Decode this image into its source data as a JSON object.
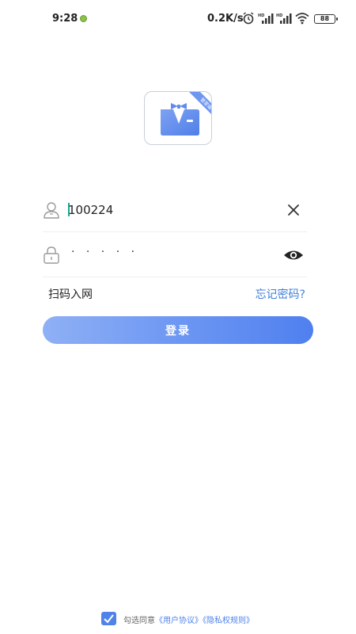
{
  "status_bar": {
    "time": "9:28",
    "net_speed": "0.2K/s",
    "battery": "88"
  },
  "login": {
    "username_value": "100224",
    "password_mask": "· · · · ·",
    "scan_label": "扫码入网",
    "forgot_label": "忘记密码?",
    "login_button": "登录"
  },
  "agreement": {
    "prefix": "勾选同意",
    "user_agreement": "《用户协议》",
    "privacy_policy": "《隐私权规则》",
    "checked": true
  },
  "colors": {
    "accent": "#4f80ef",
    "link": "#3f7fd8",
    "cursor": "#1aa692"
  }
}
